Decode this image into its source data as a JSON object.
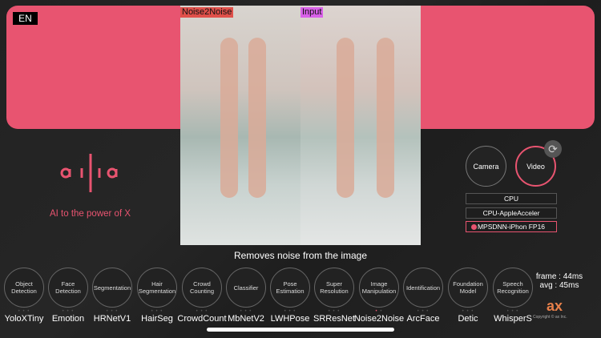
{
  "lang": "EN",
  "image_labels": {
    "output": "Noise2Noise",
    "input": "Input"
  },
  "caption": "Removes noise from the image",
  "tagline": "AI to the power of X",
  "logo_text": "ailia",
  "sources": {
    "camera": "Camera",
    "video": "Video",
    "selected": "Video"
  },
  "devices": [
    {
      "label": "CPU"
    },
    {
      "label": "CPU-AppleAcceler"
    },
    {
      "label": "MPSDNN-iPhon FP16",
      "selected": true
    }
  ],
  "categories": [
    {
      "label": "Object\nDetection",
      "model": "YoloXTiny"
    },
    {
      "label": "Face\nDetection",
      "model": "Emotion"
    },
    {
      "label": "Segmentation",
      "model": "HRNetV1"
    },
    {
      "label": "Hair\nSegmentation",
      "model": "HairSeg"
    },
    {
      "label": "Crowd\nCounting",
      "model": "CrowdCount"
    },
    {
      "label": "Classifier",
      "model": "MbNetV2"
    },
    {
      "label": "Pose\nEstimation",
      "model": "LWHPose"
    },
    {
      "label": "Super\nResolution",
      "model": "SRResNet"
    },
    {
      "label": "Image\nManipulation",
      "model": "Noise2Noise",
      "selected": true
    },
    {
      "label": "Identification",
      "model": "ArcFace"
    },
    {
      "label": "Foundation\nModel",
      "model": "Detic"
    },
    {
      "label": "Speech\nRecognition",
      "model": "WhisperS"
    }
  ],
  "stats": {
    "frame": "frame : 44ms",
    "avg": "avg : 45ms"
  },
  "brand": {
    "logo": "ax",
    "copyright": "Copyright © ax Inc."
  },
  "colors": {
    "accent": "#e85470"
  }
}
